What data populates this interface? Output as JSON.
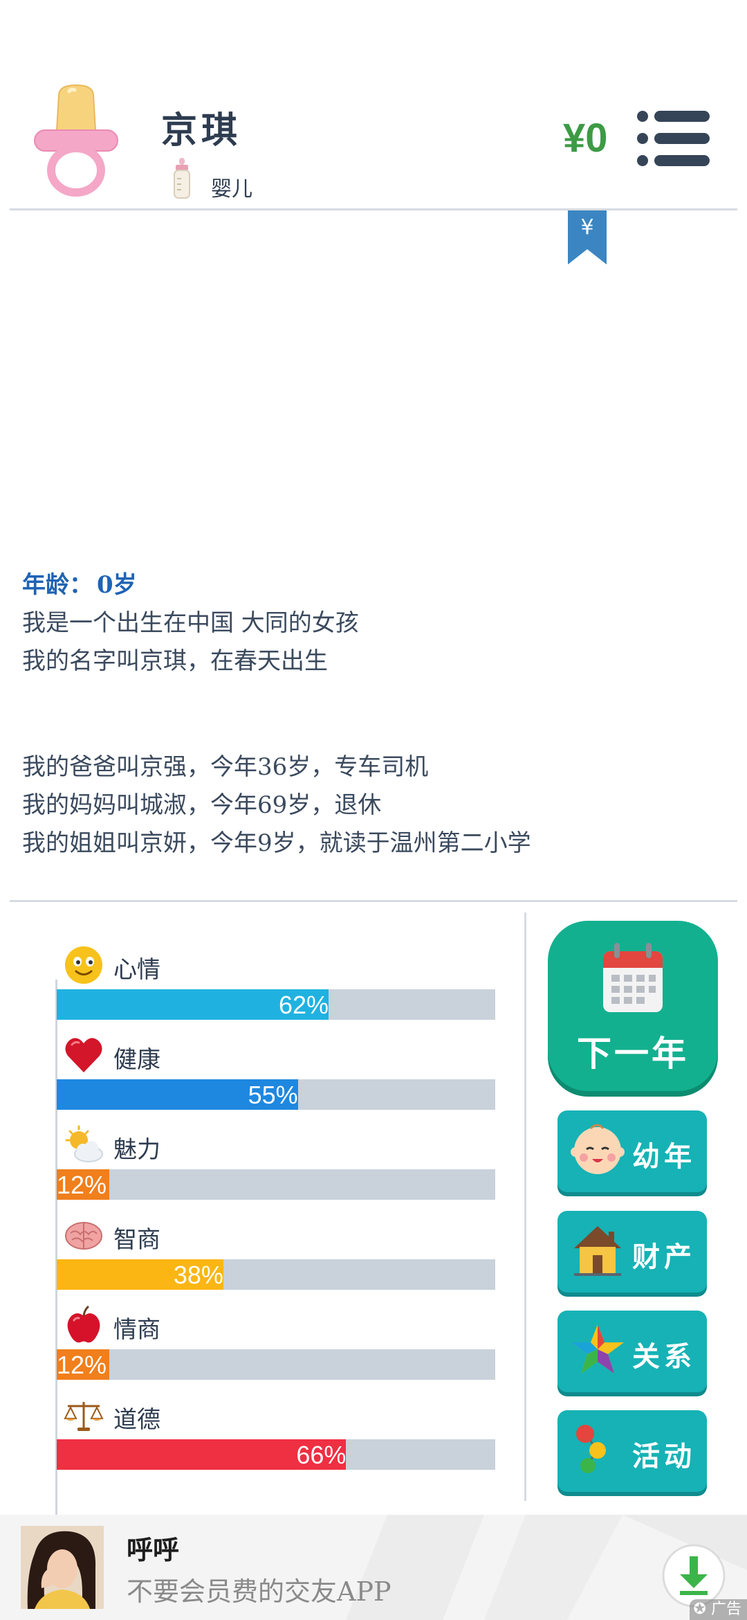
{
  "header": {
    "character_name": "京琪",
    "life_stage": "婴儿",
    "money": "¥0",
    "bookmark_symbol": "¥"
  },
  "story": {
    "age_label": "年龄：",
    "age_value": "0岁",
    "intro_lines": [
      "我是一个出生在中国 大同的女孩",
      "我的名字叫京琪，在春天出生"
    ],
    "family_lines": [
      "我的爸爸叫京强，今年36岁，专车司机",
      "我的妈妈叫城淑，今年69岁，退休",
      "我的姐姐叫京妍，今年9岁，就读于温州第二小学"
    ]
  },
  "stats": [
    {
      "label": "心情",
      "value": 62,
      "text": "62%",
      "color": "#1fb2e0",
      "icon": "smiley-face-icon"
    },
    {
      "label": "健康",
      "value": 55,
      "text": "55%",
      "color": "#1e88e0",
      "icon": "heart-icon"
    },
    {
      "label": "魅力",
      "value": 12,
      "text": "12%",
      "color": "#f07f1c",
      "icon": "sun-cloud-icon"
    },
    {
      "label": "智商",
      "value": 38,
      "text": "38%",
      "color": "#fbb614",
      "icon": "brain-icon"
    },
    {
      "label": "情商",
      "value": 12,
      "text": "12%",
      "color": "#f07f1c",
      "icon": "apple-icon"
    },
    {
      "label": "道德",
      "value": 66,
      "text": "66%",
      "color": "#ef2f42",
      "icon": "scales-icon"
    }
  ],
  "actions": {
    "next_year": "下一年",
    "childhood": "幼年",
    "assets": "财产",
    "relations": "关系",
    "activities": "活动"
  },
  "ad": {
    "title": "呼呼",
    "description": "不要会员费的交友APP",
    "badge": "广告"
  },
  "colors": {
    "money": "#3d9a45",
    "next_year_bg": "#13b08f",
    "side_button_bg": "#16b2b5",
    "age_line": "#1f63b4"
  }
}
